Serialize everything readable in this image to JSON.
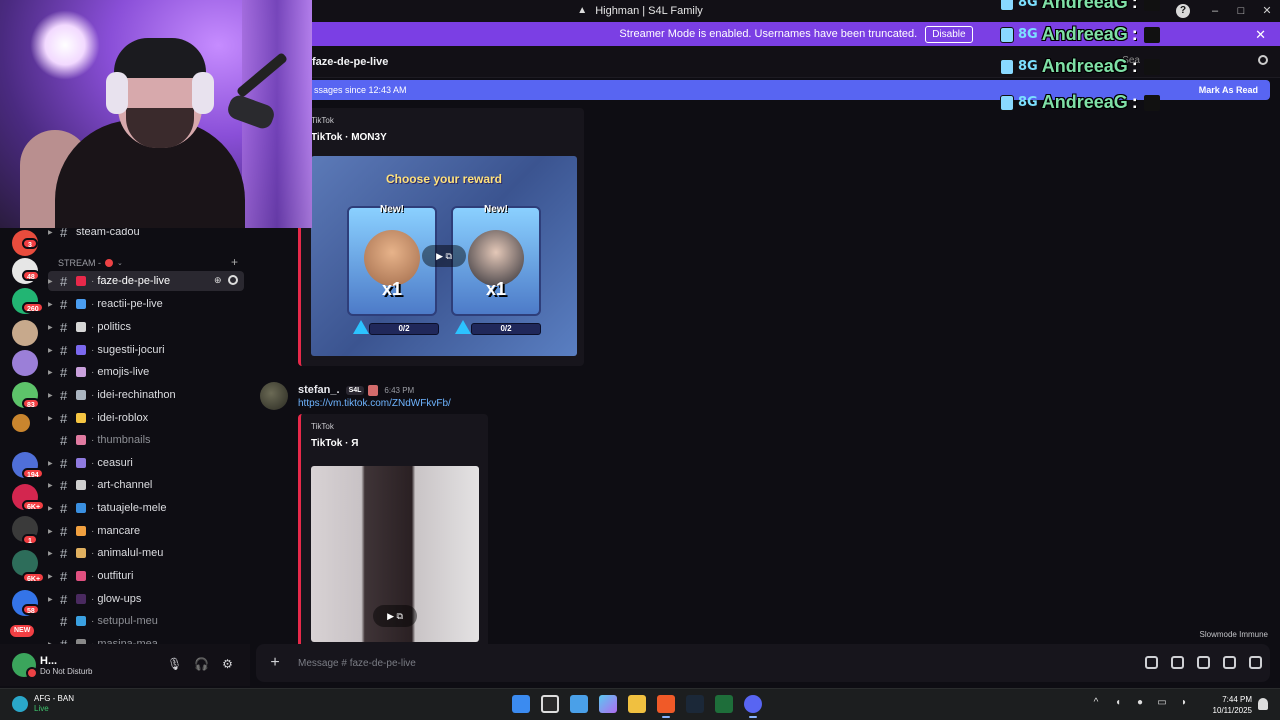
{
  "window": {
    "title": "Highman | S4L Family",
    "controls": [
      "–",
      "□",
      "✕"
    ],
    "help": "?"
  },
  "banner": {
    "text": "Streamer Mode is enabled. Usernames have been truncated.",
    "button": "Disable"
  },
  "header": {
    "channel_name": "faze-de-pe-live",
    "search_placeholder": "Sea"
  },
  "new_messages": {
    "text": "ssages since 12:43 AM",
    "action": "Mark As Read"
  },
  "chat_overlay": {
    "lines": [
      {
        "badge": "8G",
        "user": "AndreeaG",
        "colon": ":"
      },
      {
        "badge": "8G",
        "user": "AndreeaG",
        "colon": ":"
      },
      {
        "badge": "8G",
        "user": "AndreeaG",
        "colon": ":"
      },
      {
        "badge": "8G",
        "user": "AndreeaG",
        "colon": ":"
      }
    ]
  },
  "servers": {
    "mentions": [
      "3",
      "48",
      "260",
      "83",
      "194",
      "6K+",
      "1",
      "6K+",
      "58"
    ],
    "new_label": "NEW"
  },
  "channels": {
    "category": "STREAM -",
    "items": [
      {
        "name": "steam-cadou",
        "emoji_color": "",
        "muted": false
      },
      {
        "name": "faze-de-pe-live",
        "emoji_color": "#e8294a",
        "muted": false,
        "active": true
      },
      {
        "name": "reactii-pe-live",
        "emoji_color": "#4a9df0",
        "muted": false
      },
      {
        "name": "politics",
        "emoji_color": "#d6d6d6",
        "muted": false
      },
      {
        "name": "sugestii-jocuri",
        "emoji_color": "#7b68ee",
        "muted": false
      },
      {
        "name": "emojis-live",
        "emoji_color": "#c9a0dc",
        "muted": false
      },
      {
        "name": "idei-rechinathon",
        "emoji_color": "#aab4c0",
        "muted": false
      },
      {
        "name": "idei-roblox",
        "emoji_color": "#f5c542",
        "muted": false
      },
      {
        "name": "thumbnails",
        "emoji_color": "#e07aa0",
        "muted": true
      },
      {
        "name": "ceasuri",
        "emoji_color": "#8f7ae0",
        "muted": false
      },
      {
        "name": "art-channel",
        "emoji_color": "#cfcfcf",
        "muted": false
      },
      {
        "name": "tatuajele-mele",
        "emoji_color": "#3a8fe0",
        "muted": false
      },
      {
        "name": "mancare",
        "emoji_color": "#f0a040",
        "muted": false
      },
      {
        "name": "animalul-meu",
        "emoji_color": "#e0b060",
        "muted": false
      },
      {
        "name": "outfituri",
        "emoji_color": "#e05080",
        "muted": false
      },
      {
        "name": "glow-ups",
        "emoji_color": "#4a2a60",
        "muted": false
      },
      {
        "name": "setupul-meu",
        "emoji_color": "#3aa0e0",
        "muted": true
      },
      {
        "name": "masina-mea",
        "emoji_color": "#888888",
        "muted": true
      }
    ]
  },
  "user_panel": {
    "name": "H...",
    "status": "Do Not Disturb"
  },
  "messages": {
    "embed1": {
      "provider": "TikTok",
      "title": "TikTok · MON3Y",
      "video_heading": "Choose your reward",
      "card_tag": "New!",
      "card_count": "x1",
      "progress": "0/2"
    },
    "message2": {
      "author": "stefan_.",
      "tag": "S4L",
      "time": "6:43 PM",
      "link": "https://vm.tiktok.com/ZNdWFkvFb/"
    },
    "embed2": {
      "provider": "TikTok",
      "title": "TikTok · Я"
    },
    "slowmode": "Slowmode Immune"
  },
  "composer": {
    "placeholder": "Message #",
    "channel": "faze-de-pe-live"
  },
  "taskbar": {
    "weather_title": "AFG - BAN",
    "weather_sub": "Live",
    "time": "7:44 PM",
    "date": "10/11/2025"
  }
}
